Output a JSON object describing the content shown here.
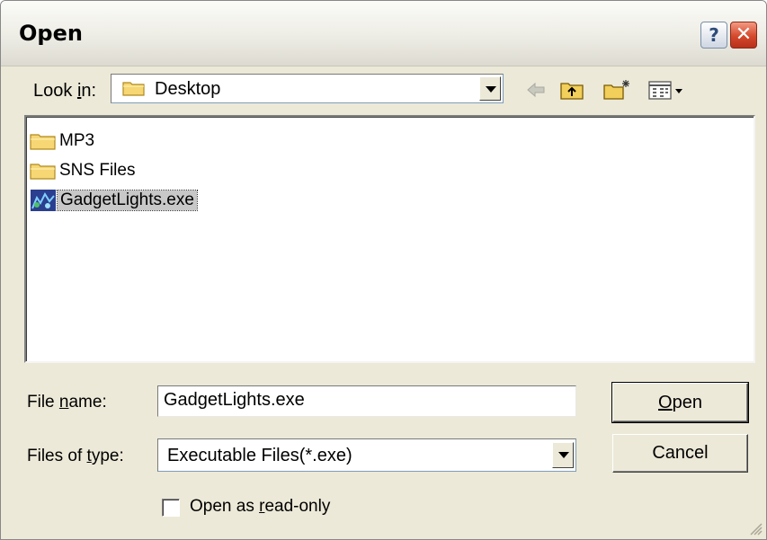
{
  "window": {
    "title": "Open"
  },
  "title_buttons": {
    "help": "?",
    "close": "✕"
  },
  "look_in": {
    "label_pre": "Look ",
    "label_u": "i",
    "label_post": "n:",
    "value": "Desktop"
  },
  "toolbar": {
    "icons": [
      "back-arrow-icon",
      "up-folder-icon",
      "new-folder-icon",
      "view-menu-icon"
    ]
  },
  "files": [
    {
      "name": "MP3",
      "icon": "folder-icon"
    },
    {
      "name": "SNS Files",
      "icon": "folder-icon"
    },
    {
      "name": "GadgetLights.exe",
      "icon": "exe-icon",
      "selected": true
    }
  ],
  "file_name": {
    "label_pre": "File ",
    "label_u": "n",
    "label_post": "ame:",
    "value": "GadgetLights.exe"
  },
  "file_type": {
    "label_pre": "Files of ",
    "label_u": "t",
    "label_post": "ype:",
    "value": "Executable Files(*.exe)"
  },
  "buttons": {
    "open_u": "O",
    "open_post": "pen",
    "cancel": "Cancel"
  },
  "read_only": {
    "label_pre": "Open as ",
    "label_u": "r",
    "label_post": "ead-only",
    "checked": false
  }
}
